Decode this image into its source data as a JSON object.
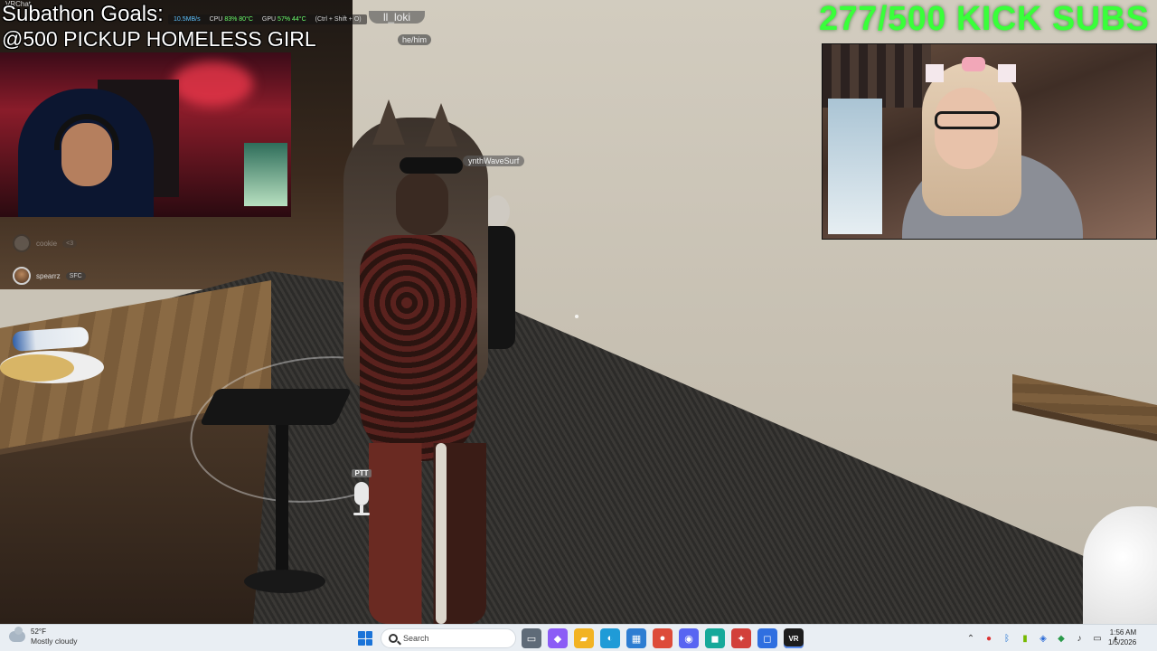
{
  "app": {
    "window_title": "VRChat"
  },
  "overlay": {
    "goals_title": "Subathon Goals:",
    "goals_line": "@500 PICKUP HOMELESS GIRL",
    "kick_subs": "277/500 KICK SUBS"
  },
  "perf_bar": {
    "net": "10.5MB/s",
    "cpu_label": "CPU",
    "cpu_load": "83%",
    "cpu_temp": "80°C",
    "gpu_label": "GPU",
    "gpu_load": "57%",
    "gpu_temp": "44°C",
    "hotkey_hint": "(Ctrl + Shift + O)"
  },
  "nameplates": {
    "loki": "ll_loki",
    "loki_pronouns": "he/him",
    "synth": "ynthWaveSurf"
  },
  "voice_list": [
    {
      "name": "cookie",
      "badge": "<3",
      "active": false
    },
    {
      "name": "spearrz",
      "badge": "SFC",
      "active": true
    }
  ],
  "ptt": {
    "label": "PTT"
  },
  "taskbar": {
    "weather_temp": "52°F",
    "weather_desc": "Mostly cloudy",
    "search_placeholder": "Search",
    "clock_time": "1:56 AM",
    "clock_date": "1/5/2026",
    "pinned_apps": [
      {
        "name": "file-explorer-window-icon",
        "color": "#5f6b78",
        "glyph": "▭"
      },
      {
        "name": "copilot-icon",
        "color": "#8b5cf6",
        "glyph": "◆"
      },
      {
        "name": "folder-icon",
        "color": "#f2b322",
        "glyph": "▰"
      },
      {
        "name": "edge-icon",
        "color": "#1f9bd7",
        "glyph": "◐"
      },
      {
        "name": "store-icon",
        "color": "#2d7dd2",
        "glyph": "▦"
      },
      {
        "name": "chrome-icon",
        "color": "#dd4b39",
        "glyph": "●"
      },
      {
        "name": "discord-icon",
        "color": "#5865f2",
        "glyph": "◉"
      },
      {
        "name": "teal-app-icon",
        "color": "#16a99a",
        "glyph": "◼"
      },
      {
        "name": "red-app-icon",
        "color": "#d2403a",
        "glyph": "✦"
      },
      {
        "name": "blue-app-icon",
        "color": "#2f6fe0",
        "glyph": "◻"
      },
      {
        "name": "vrchat-icon",
        "color": "#1d1d1d",
        "glyph": "VR",
        "active": true
      }
    ],
    "tray_icons": [
      "chevron-up-icon",
      "red-record-icon",
      "bluetooth-icon",
      "nvidia-icon",
      "shield-icon",
      "green-app-icon",
      "mic-icon",
      "monitor-icon",
      "speaker-icon"
    ]
  }
}
